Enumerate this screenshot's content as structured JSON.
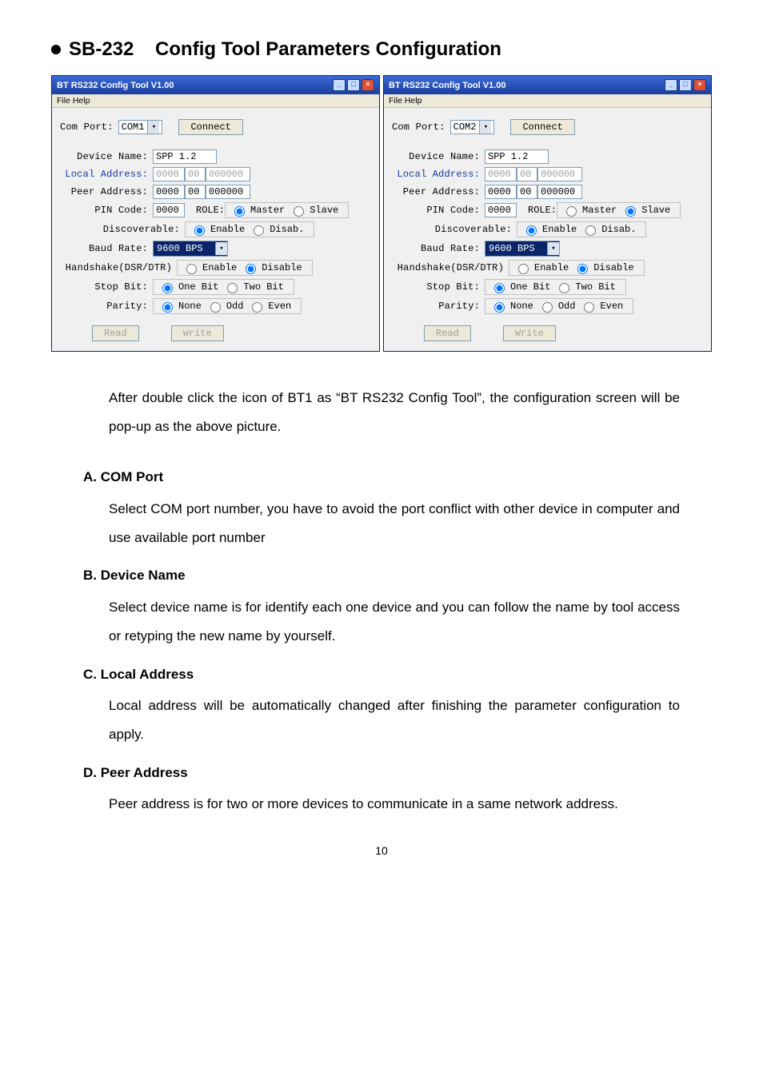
{
  "page_title_prefix": "SB-232",
  "page_title_rest": "Config Tool Parameters Configuration",
  "menubar": "File  Help",
  "winA": {
    "title": "BT RS232 Config Tool  V1.00",
    "com_label": "Com Port:",
    "com_port": "COM1",
    "connect": "Connect",
    "device_label": "Device Name:",
    "device_name": "SPP 1.2",
    "local_label": "Local Address:",
    "local": [
      "0000",
      "00",
      "000000"
    ],
    "peer_label": "Peer Address:",
    "peer": [
      "0000",
      "00",
      "000000"
    ],
    "pin_label": "PIN Code:",
    "pin": "0000",
    "role_label": "ROLE:",
    "role_master": "Master",
    "role_slave": "Slave",
    "disc_label": "Discoverable:",
    "disc_enable": "Enable",
    "disc_disable": "Disab.",
    "baud_label": "Baud Rate:",
    "baud": "9600 BPS",
    "hs_label": "Handshake(DSR/DTR)",
    "hs_enable": "Enable",
    "hs_disable": "Disable",
    "stop_label": "Stop Bit:",
    "stop_one": "One Bit",
    "stop_two": "Two Bit",
    "parity_label": "Parity:",
    "parity_none": "None",
    "parity_odd": "Odd",
    "parity_even": "Even",
    "read": "Read",
    "write": "Write"
  },
  "winB": {
    "title": "BT RS232 Config Tool  V1.00",
    "com_label": "Com Port:",
    "com_port": "COM2",
    "connect": "Connect",
    "device_label": "Device Name:",
    "device_name": "SPP 1.2",
    "local_label": "Local Address:",
    "local": [
      "0000",
      "00",
      "000000"
    ],
    "peer_label": "Peer Address:",
    "peer": [
      "0000",
      "00",
      "000000"
    ],
    "pin_label": "PIN Code:",
    "pin": "0000",
    "role_label": "ROLE:",
    "role_master": "Master",
    "role_slave": "Slave",
    "disc_label": "Discoverable:",
    "disc_enable": "Enable",
    "disc_disable": "Disab.",
    "baud_label": "Baud Rate:",
    "baud": "9600 BPS",
    "hs_label": "Handshake(DSR/DTR)",
    "hs_enable": "Enable",
    "hs_disable": "Disable",
    "stop_label": "Stop Bit:",
    "stop_one": "One Bit",
    "stop_two": "Two Bit",
    "parity_label": "Parity:",
    "parity_none": "None",
    "parity_odd": "Odd",
    "parity_even": "Even",
    "read": "Read",
    "write": "Write"
  },
  "lead": "After double click the icon of BT1 as “BT RS232 Config Tool”, the configuration screen will be pop-up as the above picture.",
  "secA": {
    "h": "A.  COM Port",
    "b": "Select COM port number, you have to avoid the port conflict with other device in computer and use available port number"
  },
  "secB": {
    "h": "B.  Device Name",
    "b": "Select device name is for identify each one device and you can follow the name by tool access or retyping the new name by yourself."
  },
  "secC": {
    "h": "C.  Local Address",
    "b": "Local address will be automatically changed after finishing the parameter configuration to apply."
  },
  "secD": {
    "h": "D.  Peer Address",
    "b": "Peer address is for two or more devices to communicate in a same network address."
  },
  "page_number": "10"
}
